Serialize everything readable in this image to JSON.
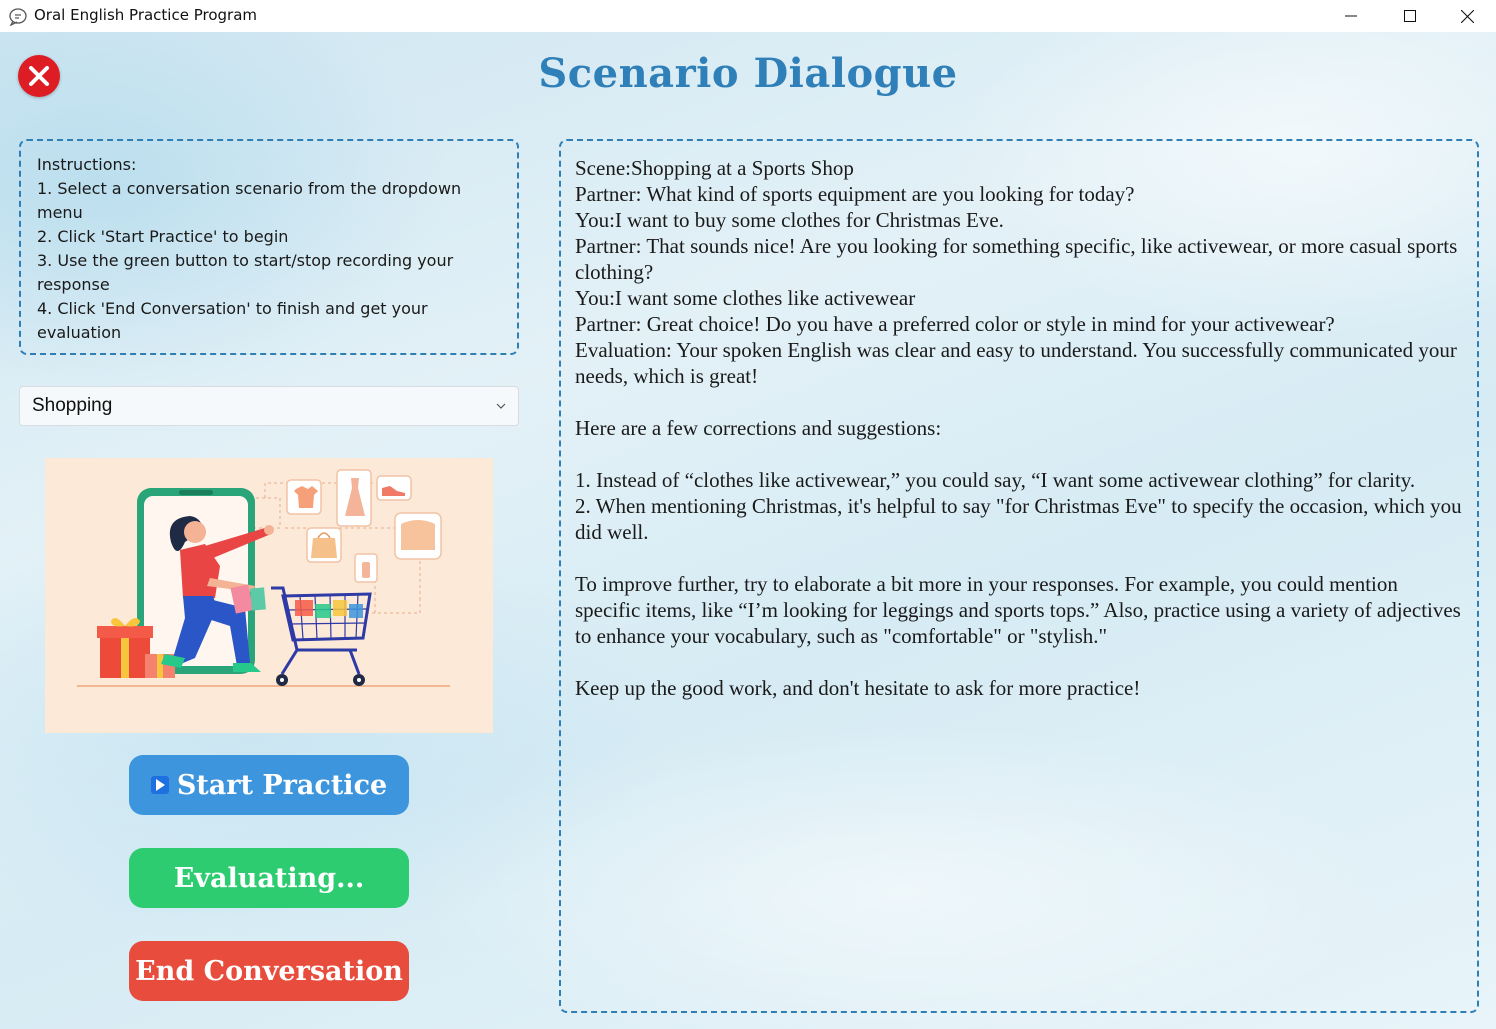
{
  "window": {
    "title": "Oral English Practice Program"
  },
  "header": {
    "title": "Scenario Dialogue"
  },
  "instructions": {
    "heading": "Instructions:",
    "steps": [
      "1. Select a conversation scenario from the dropdown menu",
      "2. Click 'Start Practice' to begin",
      "3. Use the green button to start/stop recording your response",
      "4. Click 'End Conversation' to finish and get your evaluation"
    ]
  },
  "scenario_select": {
    "selected": "Shopping"
  },
  "buttons": {
    "start": "Start Practice",
    "evaluate": "Evaluating...",
    "end": "End Conversation"
  },
  "colors": {
    "accent": "#2f7fb8",
    "start_button": "#3d95dd",
    "evaluate_button": "#2ecc71",
    "end_button": "#e74c3c",
    "close_button": "#dd1c24"
  },
  "icons": {
    "close": "close-circle-icon",
    "dropdown": "chevron-down-icon",
    "play": "play-icon"
  },
  "dialogue": {
    "lines": [
      "Scene:Shopping at a Sports Shop",
      "Partner: What kind of sports equipment are you looking for today?",
      "You:I want to buy some clothes for Christmas Eve.",
      "Partner: That sounds nice! Are you looking for something specific, like activewear, or more casual sports clothing?",
      "You:I want some clothes like activewear",
      "Partner: Great choice! Do you have a preferred color or style in mind for your activewear?",
      "Evaluation: Your spoken English was clear and easy to understand. You successfully communicated your needs, which is great!",
      "",
      "Here are a few corrections and suggestions:",
      "",
      "1. Instead of “clothes like activewear,” you could say, “I want some activewear clothing” for clarity.",
      "2. When mentioning Christmas, it's helpful to say \"for Christmas Eve\" to specify the occasion, which you did well.",
      "",
      "To improve further, try to elaborate a bit more in your responses. For example, you could mention specific items, like “I’m looking for leggings and sports tops.” Also, practice using a variety of adjectives to enhance your vocabulary, such as \"comfortable\" or \"stylish.\"",
      "",
      "Keep up the good work, and don't hesitate to ask for more practice!"
    ]
  }
}
